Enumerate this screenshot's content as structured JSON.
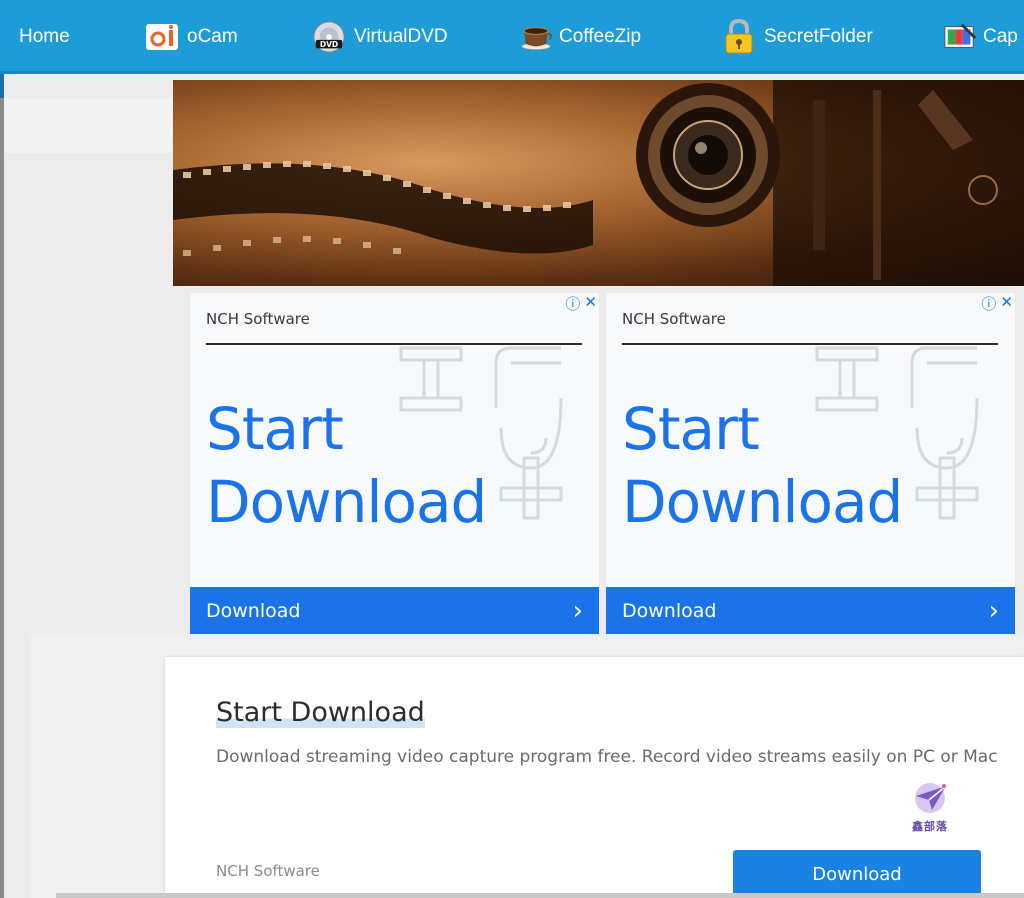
{
  "nav": {
    "items": [
      {
        "label": "Home",
        "icon": "none"
      },
      {
        "label": "oCam",
        "icon": "ocam-icon"
      },
      {
        "label": "VirtualDVD",
        "icon": "dvd-icon"
      },
      {
        "label": "CoffeeZip",
        "icon": "coffee-cup-icon"
      },
      {
        "label": "SecretFolder",
        "icon": "padlock-icon"
      },
      {
        "label": "Cap",
        "icon": "capture-icon"
      }
    ],
    "background": "#1e9cd8"
  },
  "ads": [
    {
      "brand": "NCH Software",
      "headline_line1": "Start",
      "headline_line2": "Download",
      "button_label": "Download",
      "button_arrow": "›",
      "info_icon": "ⓘ",
      "close_icon": "✕"
    },
    {
      "brand": "NCH Software",
      "headline_line1": "Start",
      "headline_line2": "Download",
      "button_label": "Download",
      "button_arrow": "›",
      "info_icon": "ⓘ",
      "close_icon": "✕"
    }
  ],
  "card": {
    "title": "Start Download",
    "description": "Download streaming video capture program free. Record video streams easily on PC or Mac",
    "brand": "NCH Software",
    "button_label": "Download",
    "watermark_text": "鑫部落"
  },
  "colors": {
    "accent": "#1a73e8",
    "card_button": "#1a82e2"
  }
}
